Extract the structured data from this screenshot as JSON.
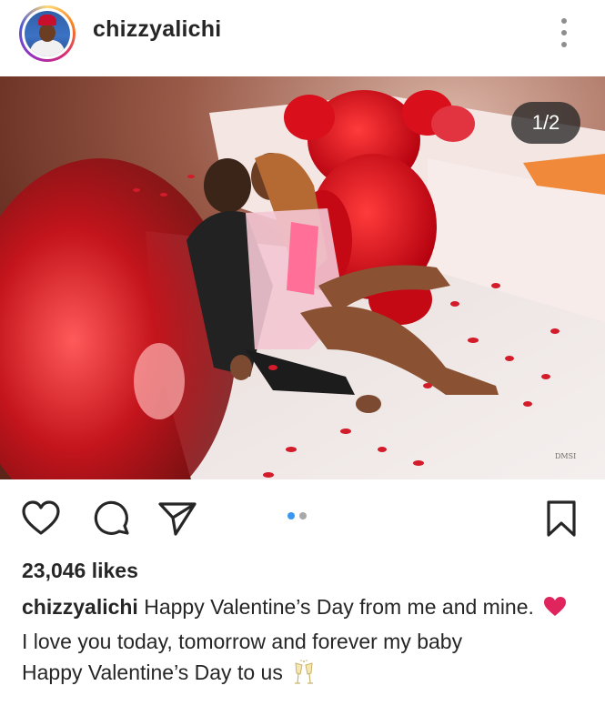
{
  "post": {
    "username": "chizzyalichi",
    "image_counter": "1/2",
    "watermark": "DMSI",
    "carousel": {
      "total": 2,
      "active_index": 0
    },
    "likes": "23,046 likes",
    "caption": {
      "username": "chizzyalichi",
      "line1": " Happy Valentine’s Day from me and mine.",
      "line2": "I love you today, tomorrow and forever my baby",
      "line3": "Happy Valentine’s Day to us"
    }
  },
  "icons": {
    "more": "more-options-icon",
    "like": "heart-icon",
    "comment": "comment-icon",
    "share": "share-icon",
    "save": "bookmark-icon"
  },
  "colors": {
    "text": "#262626",
    "active_dot": "#3897f0",
    "inactive_dot": "#a8a8a8",
    "emoji_heart": "#e0245e"
  }
}
